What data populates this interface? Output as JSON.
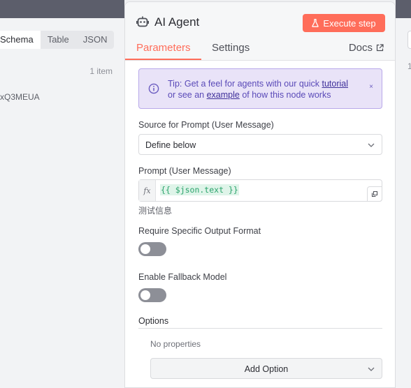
{
  "left_panel": {
    "view_tabs": [
      "Schema",
      "Table",
      "JSON"
    ],
    "active_tab": "Schema",
    "item_count": "1 item",
    "row_value": "xQ3MEUA"
  },
  "right_panel": {
    "item_count_partial": "1"
  },
  "node": {
    "title": "AI Agent",
    "execute_label": "Execute step",
    "icon": "robot-icon"
  },
  "tabs": {
    "parameters": "Parameters",
    "settings": "Settings",
    "docs": "Docs"
  },
  "tip": {
    "prefix": "Tip: Get a feel for agents with our quick ",
    "link1": "tutorial",
    "middle": "or see an ",
    "link2": "example",
    "suffix": " of how this node works",
    "close": "×"
  },
  "fields": {
    "source_label": "Source for Prompt (User Message)",
    "source_value": "Define below",
    "prompt_label": "Prompt (User Message)",
    "prompt_fx": "fx",
    "prompt_expression": "{{ $json.text }}",
    "prompt_hint": "测试信息",
    "output_format_label": "Require Specific Output Format",
    "output_format_enabled": false,
    "fallback_label": "Enable Fallback Model",
    "fallback_enabled": false
  },
  "options": {
    "label": "Options",
    "empty_text": "No properties",
    "add_option_label": "Add Option"
  },
  "colors": {
    "accent": "#ff6d5a",
    "tip_bg": "#e9e3f8",
    "tip_text": "#5a4ab8",
    "toggle_off": "#8d8f97",
    "expression_green": "#2aa36b"
  }
}
